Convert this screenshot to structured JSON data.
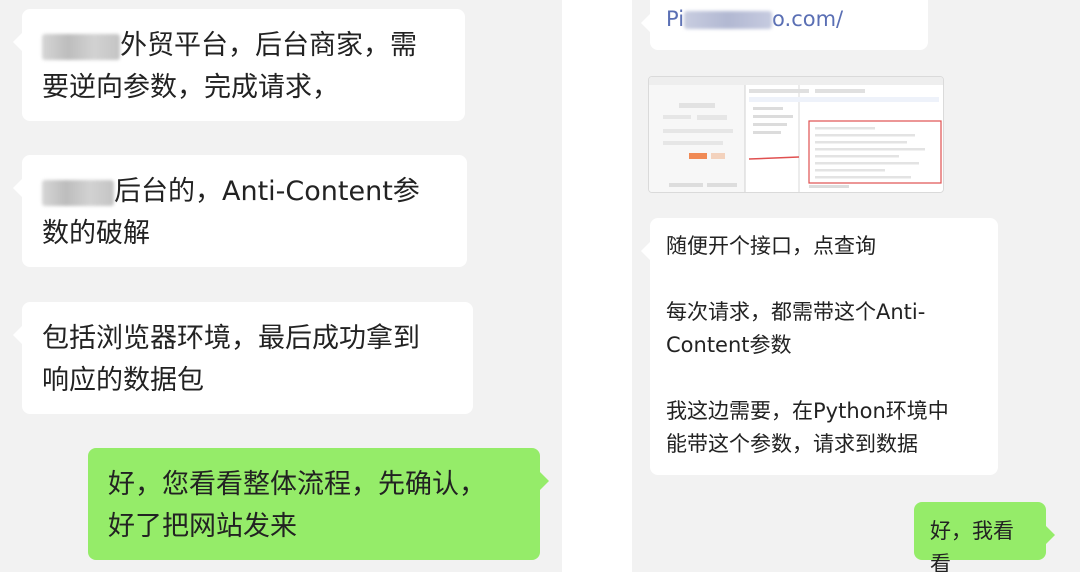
{
  "left_chat": {
    "msg1_suffix": "外贸平台，后台商家，需",
    "msg1_line2": "要逆向参数，完成请求，",
    "msg2_suffix": "后台的，Anti-Content参",
    "msg2_line2": "数的破解",
    "msg3_line1": "包括浏览器环境，最后成功拿到",
    "msg3_line2": "响应的数据包",
    "reply_line1": "好，您看看整体流程，先确认，",
    "reply_line2": "好了把网站发来"
  },
  "right_chat": {
    "link_prefix": "Pi",
    "link_suffix": "o.com/",
    "msg1": "随便开个接口，点查询",
    "msg2_line1": "每次请求，都需带这个Anti-",
    "msg2_line2": "Content参数",
    "msg3_line1": "我这边需要，在Python环境中",
    "msg3_line2": "能带这个参数，请求到数据",
    "reply": "好，我看看"
  },
  "colors": {
    "chat_background": "#f2f2f2",
    "incoming_bubble": "#ffffff",
    "outgoing_bubble": "#95ec69",
    "link_text": "#5a6fb4",
    "highlight_red": "#e05050"
  }
}
